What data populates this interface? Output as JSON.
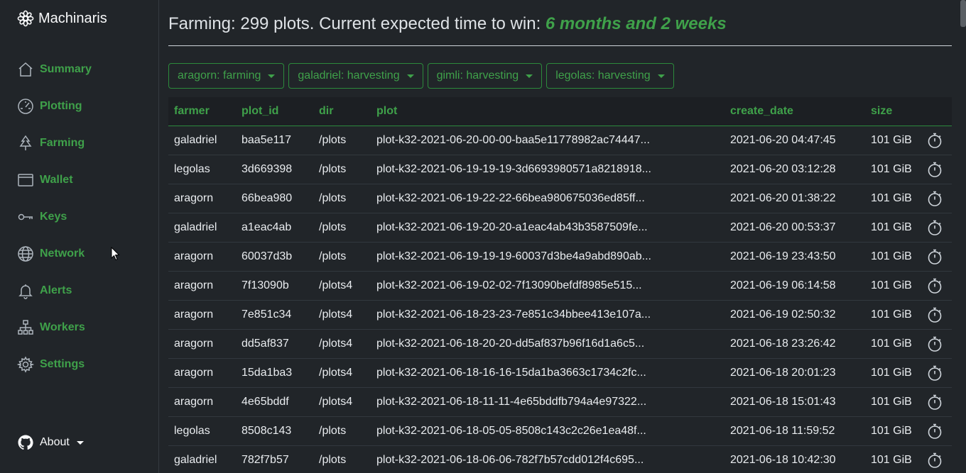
{
  "brand": {
    "name": "Machinaris"
  },
  "nav": {
    "items": [
      {
        "label": "Summary",
        "icon": "house-icon"
      },
      {
        "label": "Plotting",
        "icon": "speedometer-icon"
      },
      {
        "label": "Farming",
        "icon": "tree-icon"
      },
      {
        "label": "Wallet",
        "icon": "wallet-icon"
      },
      {
        "label": "Keys",
        "icon": "key-icon"
      },
      {
        "label": "Network",
        "icon": "globe-icon"
      },
      {
        "label": "Alerts",
        "icon": "bell-icon"
      },
      {
        "label": "Workers",
        "icon": "diagram-icon"
      },
      {
        "label": "Settings",
        "icon": "gear-icon"
      }
    ],
    "about": {
      "label": "About",
      "icon": "github-icon"
    }
  },
  "header": {
    "prefix": "Farming: 299 plots. Current expected time to win: ",
    "eta": "6 months and 2 weeks"
  },
  "workers": [
    {
      "label": "aragorn: farming"
    },
    {
      "label": "galadriel: harvesting"
    },
    {
      "label": "gimli: harvesting"
    },
    {
      "label": "legolas: harvesting"
    }
  ],
  "table": {
    "headers": [
      "farmer",
      "plot_id",
      "dir",
      "plot",
      "create_date",
      "size",
      ""
    ],
    "rows": [
      [
        "galadriel",
        "baa5e117",
        "/plots",
        "plot-k32-2021-06-20-00-00-baa5e11778982ac74447...",
        "2021-06-20 04:47:45",
        "101 GiB"
      ],
      [
        "legolas",
        "3d669398",
        "/plots",
        "plot-k32-2021-06-19-19-19-3d6693980571a8218918...",
        "2021-06-20 03:12:28",
        "101 GiB"
      ],
      [
        "aragorn",
        "66bea980",
        "/plots",
        "plot-k32-2021-06-19-22-22-66bea980675036ed85ff...",
        "2021-06-20 01:38:22",
        "101 GiB"
      ],
      [
        "galadriel",
        "a1eac4ab",
        "/plots",
        "plot-k32-2021-06-19-20-20-a1eac4ab43b3587509fe...",
        "2021-06-20 00:53:37",
        "101 GiB"
      ],
      [
        "aragorn",
        "60037d3b",
        "/plots",
        "plot-k32-2021-06-19-19-19-60037d3be4a9abd890ab...",
        "2021-06-19 23:43:50",
        "101 GiB"
      ],
      [
        "aragorn",
        "7f13090b",
        "/plots4",
        "plot-k32-2021-06-19-02-02-7f13090befdf8985e515...",
        "2021-06-19 06:14:58",
        "101 GiB"
      ],
      [
        "aragorn",
        "7e851c34",
        "/plots4",
        "plot-k32-2021-06-18-23-23-7e851c34bbee413e107a...",
        "2021-06-19 02:50:32",
        "101 GiB"
      ],
      [
        "aragorn",
        "dd5af837",
        "/plots4",
        "plot-k32-2021-06-18-20-20-dd5af837b96f16d1a6c5...",
        "2021-06-18 23:26:42",
        "101 GiB"
      ],
      [
        "aragorn",
        "15da1ba3",
        "/plots4",
        "plot-k32-2021-06-18-16-16-15da1ba3663c1734c2fc...",
        "2021-06-18 20:01:23",
        "101 GiB"
      ],
      [
        "aragorn",
        "4e65bddf",
        "/plots4",
        "plot-k32-2021-06-18-11-11-4e65bddfb794a4e97322...",
        "2021-06-18 15:01:43",
        "101 GiB"
      ],
      [
        "legolas",
        "8508c143",
        "/plots",
        "plot-k32-2021-06-18-05-05-8508c143c2c26e1ea48f...",
        "2021-06-18 11:59:52",
        "101 GiB"
      ],
      [
        "galadriel",
        "782f7b57",
        "/plots",
        "plot-k32-2021-06-18-06-06-782f7b57cdd012f4c695...",
        "2021-06-18 10:42:30",
        "101 GiB"
      ]
    ],
    "row_icon": "stopwatch-icon"
  },
  "colors": {
    "accent": "#3fa14a",
    "background": "#212529",
    "header_bg": "#1c1f23"
  }
}
